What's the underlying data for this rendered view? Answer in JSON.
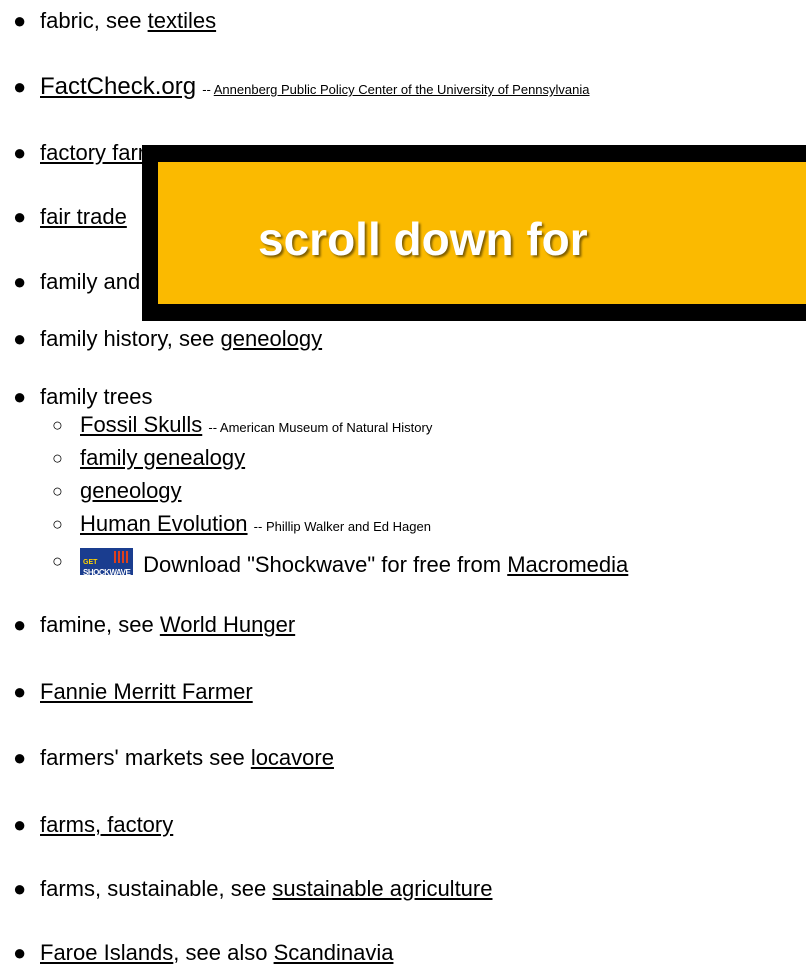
{
  "items": [
    {
      "pre": "fabric, see ",
      "link": "textiles"
    },
    {
      "link": "FactCheck.org",
      "note": "-- ",
      "note_link": "Annenberg Public Policy Center of the University of Pennsylvania"
    },
    {
      "link": "factory farms"
    },
    {
      "link": "fair trade"
    },
    {
      "pre": "family and"
    },
    {
      "pre": "family history, see ",
      "link": "geneology"
    },
    {
      "pre": "family trees"
    },
    {
      "pre": "famine, see ",
      "link": "World Hunger"
    },
    {
      "link": "Fannie Merritt Farmer"
    },
    {
      "pre": "farmers' markets see ",
      "link": "locavore"
    },
    {
      "link": "farms, factory"
    },
    {
      "pre": "farms, sustainable, see ",
      "link": "sustainable agriculture"
    },
    {
      "link": "Faroe Islands",
      "mid": ", see also ",
      "link2": "Scandinavia"
    }
  ],
  "family_trees_sub": [
    {
      "link": "Fossil Skulls",
      "note": "-- American Museum of Natural History"
    },
    {
      "link": "family genealogy"
    },
    {
      "link": "geneology"
    },
    {
      "link": "Human Evolution",
      "note": "-- Phillip Walker and Ed Hagen"
    }
  ],
  "shockwave": {
    "badge_top": "GET",
    "badge_bottom": "SHOCKWAVE",
    "text": "Download \"Shockwave\" for free from ",
    "link": "Macromedia"
  },
  "overlay": {
    "text": "scroll down for"
  },
  "colors": {
    "overlay_bg": "#fbba00",
    "overlay_border": "#000000"
  }
}
